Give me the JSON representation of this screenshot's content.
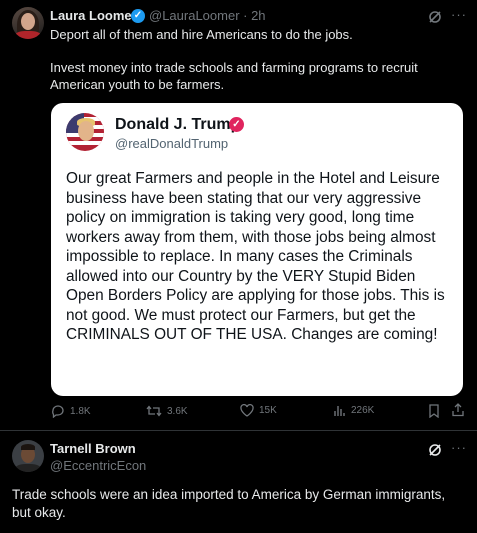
{
  "main_post": {
    "author_name": "Laura Loomer",
    "handle_time": "@LauraLoomer · 2h",
    "text_line1": "Deport all of them and hire Americans to do the jobs.",
    "text_para2": "Invest money into trade schools and farming programs to recruit American youth to be farmers.",
    "more_label": "···"
  },
  "quoted_post": {
    "author_name": "Donald J. Trump",
    "handle": "@realDonaldTrump",
    "body": "Our great Farmers and people in the Hotel and Leisure business have been stating that our very aggressive policy on immigration is taking very good, long time workers away from them, with those jobs being almost impossible to replace. In many cases the Criminals allowed into our Country by the VERY Stupid Biden Open Borders Policy are applying for those jobs. This is not good. We must protect our Farmers, but get the CRIMINALS OUT OF THE USA. Changes are coming!"
  },
  "actions": {
    "replies": "1.8K",
    "reposts": "3.6K",
    "likes": "15K",
    "views": "226K"
  },
  "reply": {
    "author_name": "Tarnell Brown",
    "handle": "@EccentricEcon",
    "text": "Trade schools were an idea imported to America by German immigrants, but okay.",
    "more_label": "···"
  },
  "icons": {
    "verified": "verified-check-icon",
    "grok": "grok-icon",
    "reply": "reply-icon",
    "repost": "repost-icon",
    "like": "heart-icon",
    "views": "views-icon",
    "bookmark": "bookmark-icon",
    "share": "share-icon"
  },
  "colors": {
    "background": "#000000",
    "text": "#e7e9ea",
    "secondary": "#71767b",
    "verified_blue": "#1d9bf0",
    "verified_red": "#e0245e"
  }
}
